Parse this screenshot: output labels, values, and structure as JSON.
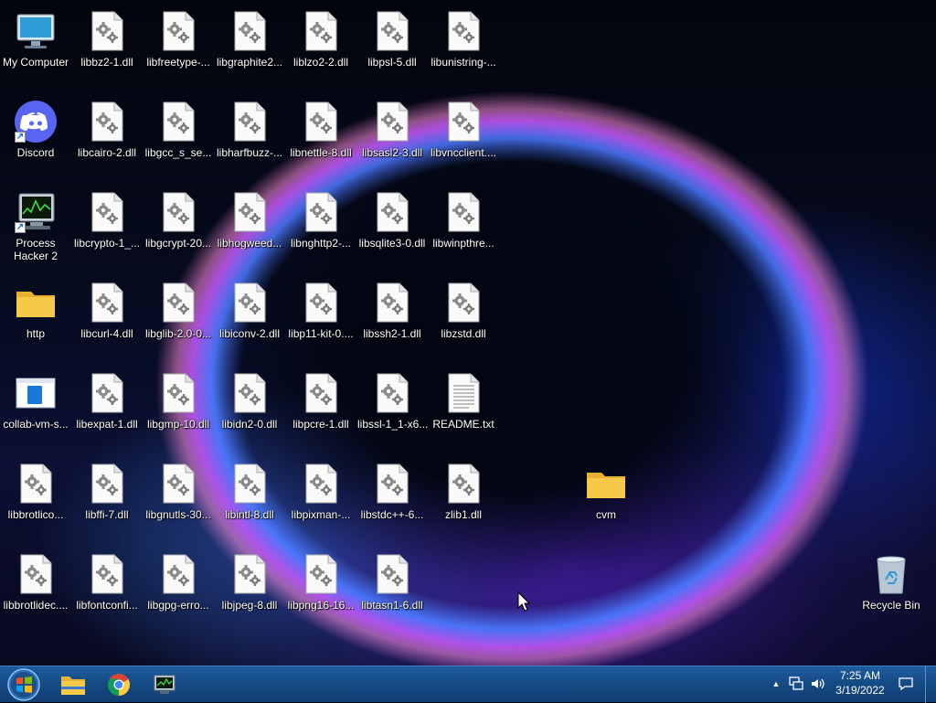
{
  "desktop": {
    "icons": {
      "my_computer": "My Computer",
      "discord": "Discord",
      "process_hacker": "Process Hacker 2",
      "http": "http",
      "collab": "collab-vm-s...",
      "libbrotlico": "libbrotlico...",
      "libbrotlidec": "libbrotlidec....",
      "libbz2": "libbz2-1.dll",
      "libcairo": "libcairo-2.dll",
      "libcrypto": "libcrypto-1_...",
      "libcurl": "libcurl-4.dll",
      "libexpat": "libexpat-1.dll",
      "libffi": "libffi-7.dll",
      "libfontconfig": "libfontconfi...",
      "libfreetype": "libfreetype-...",
      "libgcc": "libgcc_s_se...",
      "libgcrypt": "libgcrypt-20...",
      "libglib": "libglib-2.0-0...",
      "libgmp": "libgmp-10.dll",
      "libgnutls": "libgnutls-30...",
      "libgpg": "libgpg-erro...",
      "libgraphite": "libgraphite2...",
      "libharfbuzz": "libharfbuzz-...",
      "libhogweed": "libhogweed...",
      "libiconv": "libiconv-2.dll",
      "libidn2": "libidn2-0.dll",
      "libintl": "libintl-8.dll",
      "libjpeg": "libjpeg-8.dll",
      "liblzo2": "liblzo2-2.dll",
      "libnettle": "libnettle-8.dll",
      "libnghttp2": "libnghttp2-...",
      "libp11": "libp11-kit-0....",
      "libpcre": "libpcre-1.dll",
      "libpixman": "libpixman-...",
      "libpng16": "libpng16-16...",
      "libpsl": "libpsl-5.dll",
      "libsasl2": "libsasl2-3.dll",
      "libsqlite3": "libsqlite3-0.dll",
      "libssh2": "libssh2-1.dll",
      "libssl": "libssl-1_1-x6...",
      "libstdc": "libstdc++-6...",
      "libtasn1": "libtasn1-6.dll",
      "libunistring": "libunistring-...",
      "libvncclient": "libvncclient....",
      "libwinpthread": "libwinpthre...",
      "libzstd": "libzstd.dll",
      "readme": "README.txt",
      "zlib1": "zlib1.dll",
      "cvm": "cvm",
      "recycle_bin": "Recycle Bin"
    }
  },
  "taskbar": {
    "clock_time": "7:25 AM",
    "clock_date": "3/19/2022",
    "tray_expand": "▲"
  },
  "colors": {
    "taskbar": "#154a84",
    "folder": "#f7c948",
    "discord": "#5865f2"
  }
}
